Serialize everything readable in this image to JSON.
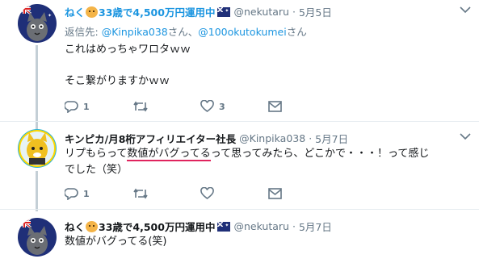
{
  "tweets": [
    {
      "name_prefix": "ねく",
      "name_suffix": "33歳で4,500万円運用中",
      "handle": "@nekutaru",
      "dot": "·",
      "date": "5月5日",
      "replying_label": "返信先: ",
      "reply_to_1": "@Kinpika038",
      "reply_join": "さん、",
      "reply_to_2": "@100okutokumei",
      "reply_end": "さん",
      "line1": "これはめっちゃワロタｗｗ",
      "line2": "そこ繋がりますかｗｗ",
      "reply_count": "1",
      "retweet_count": "",
      "like_count": "3"
    },
    {
      "name": "キンピカ/月8桁アフィリエイター社長",
      "handle": "@Kinpika038",
      "dot": "·",
      "date": "5月7日",
      "line1_pre": "リプもらって",
      "line1_highlight": "数値がバグってる",
      "line1_post": "って思ってみたら、どこかで・・・！って感じ",
      "line2": "でした（笑）",
      "reply_count": "1",
      "retweet_count": "",
      "like_count": ""
    },
    {
      "name_prefix": "ねく",
      "name_suffix": "33歳で4,500万円運用中",
      "handle": "@nekutaru",
      "dot": "·",
      "date": "5月7日",
      "line1": "数値がバグってる(笑)"
    }
  ],
  "icons": {
    "reply": "reply-icon",
    "retweet": "retweet-icon",
    "like": "heart-icon",
    "dm": "envelope-icon",
    "more": "chevron-down-icon"
  },
  "colors": {
    "link": "#1b95e0",
    "muted": "#657786",
    "thread_line": "#c4cfd6",
    "underline": "#e0245e"
  }
}
